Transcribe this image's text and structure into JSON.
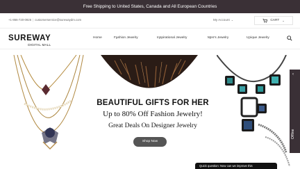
{
  "announcement": "Free Shipping to United States, Canada and All European Countries",
  "header": {
    "phone": "+1-866-720-0926",
    "email": "customerservice@surewaydm.com",
    "account_label": "My Account",
    "cart_label": "CART"
  },
  "logo": {
    "line1": "SUREWAY",
    "line2": "DIGITAL MALL"
  },
  "nav": {
    "items": [
      {
        "label": "Home"
      },
      {
        "label": "Fashion Jewelry"
      },
      {
        "label": "Inspirational Jewelry"
      },
      {
        "label": "Men's Jewelry"
      },
      {
        "label": "Unique Jewelry"
      }
    ]
  },
  "hero": {
    "title": "BEAUTIFUL GIFTS FOR HER",
    "subtitle": "Up to 80% Off Fashion Jewelry!",
    "tagline": "Great Deals On Designer Jewelry",
    "cta": "Shop Now"
  },
  "offline_tab": "Offline",
  "chat_bar": "Quick question: Now can we improve this"
}
